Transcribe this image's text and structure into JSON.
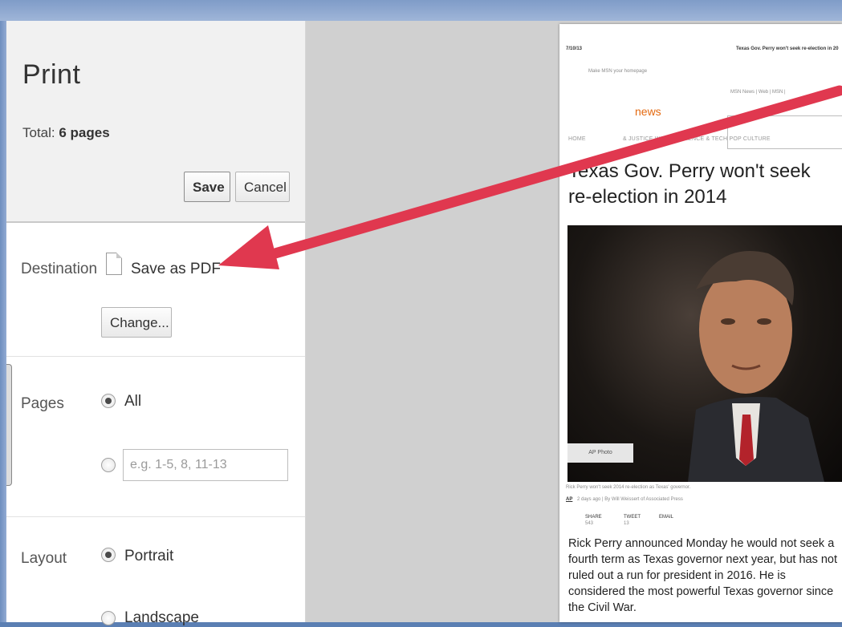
{
  "dialog": {
    "title": "Print",
    "total_label": "Total: ",
    "total_value": "6 pages",
    "save_label": "Save",
    "cancel_label": "Cancel"
  },
  "destination": {
    "label": "Destination",
    "value": "Save as PDF",
    "change_label": "Change...",
    "icon": "document-icon"
  },
  "pages": {
    "label": "Pages",
    "all_label": "All",
    "all_selected": true,
    "custom_placeholder": "e.g. 1-5, 8, 11-13"
  },
  "layout": {
    "label": "Layout",
    "portrait_label": "Portrait",
    "landscape_label": "Landscape",
    "selected": "Portrait"
  },
  "preview": {
    "date": "7/10/13",
    "page_title": "Texas Gov. Perry won't seek re-election in 20",
    "homepage_link": "Make MSN your homepage",
    "top_links": "MSN News  |  Web  |  MSN  |",
    "news_logo": "news",
    "nav": "HOME",
    "nav_items": "& JUSTICE   WORLD   SCIENCE & TECH   POP CULTURE",
    "headline": "Texas Gov. Perry won't seek re-election in 2014",
    "photo_credit": "AP Photo",
    "caption": "Rick Perry won't seek 2014 re-election as Texas' governor.",
    "byline_source": "AP",
    "byline": "2 days ago  |  By Will Weissert of Associated Press",
    "share_label": "SHARE",
    "share_count": "543",
    "tweet_label": "TWEET",
    "tweet_count": "13",
    "email_label": "EMAIL",
    "article_text": "Rick Perry announced Monday he would not seek a fourth term as Texas governor next year, but has not ruled out a run for president in 2016. He is considered the most powerful Texas governor since the Civil War."
  },
  "annotation": {
    "arrow_color": "#e0384f"
  }
}
